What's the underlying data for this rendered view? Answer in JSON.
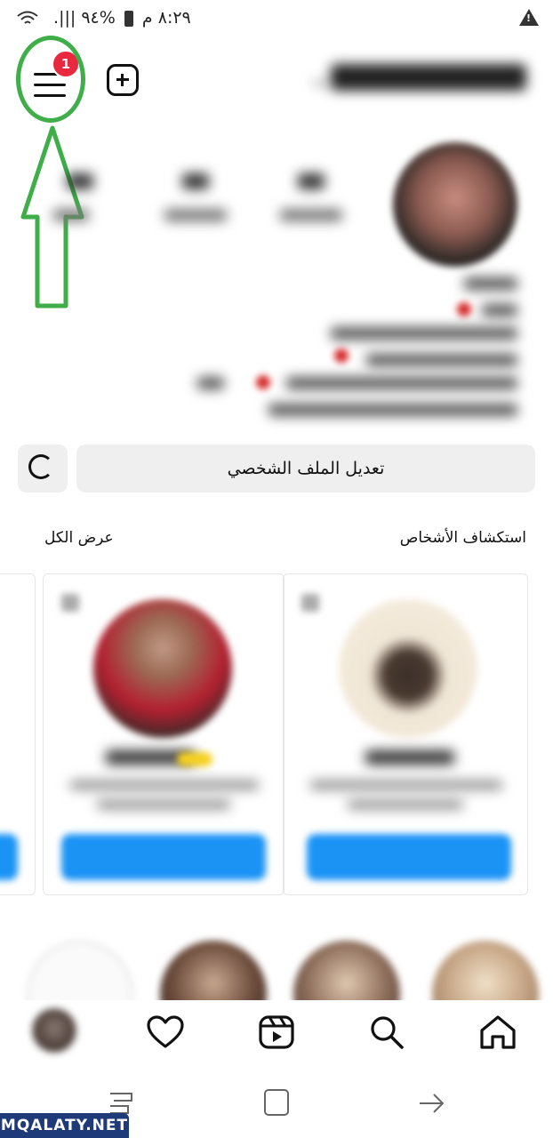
{
  "status_bar": {
    "time": "٨:٢٩ م",
    "battery": "%٩٤",
    "alert_icon": "warning-triangle-icon"
  },
  "header": {
    "menu_icon": "hamburger-menu-icon",
    "notification_badge": "1",
    "add_icon": "plus-square-icon"
  },
  "profile": {
    "edit_profile_label": "تعديل الملف الشخصي",
    "refresh_icon": "refresh-icon"
  },
  "discover": {
    "title": "استكشاف الأشخاص",
    "see_all": "عرض الكل"
  },
  "bottom_nav": {
    "items": [
      "home-icon",
      "search-icon",
      "reels-icon",
      "heart-icon",
      "profile-avatar"
    ]
  },
  "watermark": "MQALATY.NET",
  "colors": {
    "accent_blue": "#1a93f5",
    "annotation_green": "#3fae49",
    "badge_red": "#e8283f"
  }
}
